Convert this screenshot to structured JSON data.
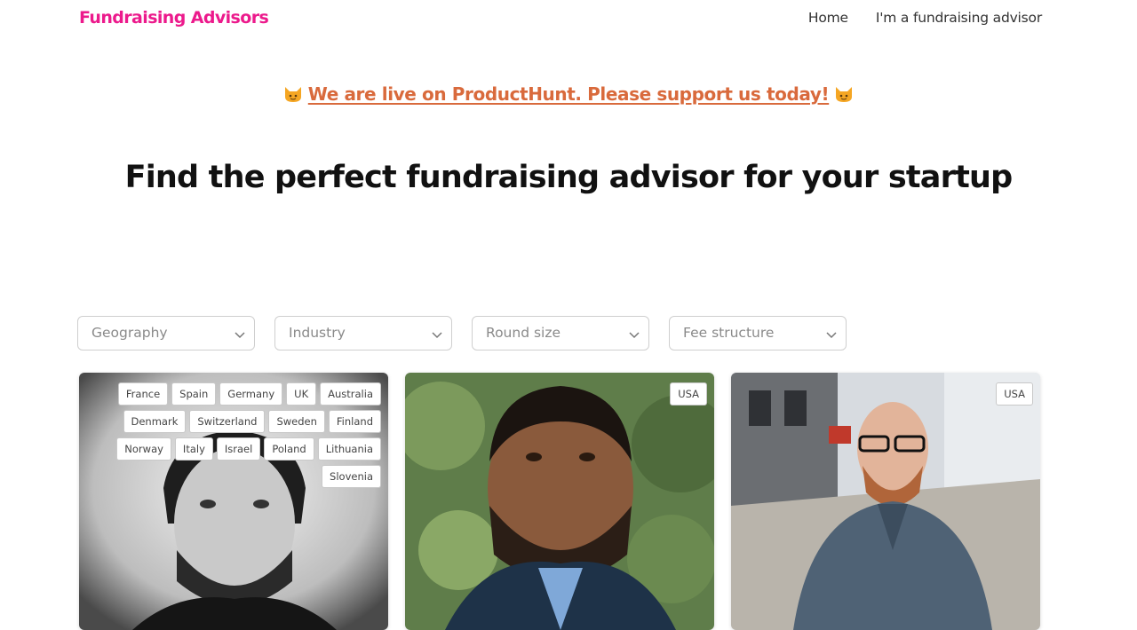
{
  "nav": {
    "brand": "Fundraising Advisors",
    "links": [
      "Home",
      "I'm a fundraising advisor"
    ]
  },
  "promo": {
    "text": "We are live on ProductHunt. Please support us today!",
    "icon": "cat-emoji-icon"
  },
  "hero": {
    "title": "Find the perfect fundraising advisor for your startup"
  },
  "filters": [
    {
      "placeholder": "Geography"
    },
    {
      "placeholder": "Industry"
    },
    {
      "placeholder": "Round size"
    },
    {
      "placeholder": "Fee structure"
    }
  ],
  "advisors": [
    {
      "countries": [
        "France",
        "Spain",
        "Germany",
        "UK",
        "Australia",
        "Denmark",
        "Switzerland",
        "Sweden",
        "Finland",
        "Norway",
        "Italy",
        "Israel",
        "Poland",
        "Lithuania",
        "Slovenia"
      ]
    },
    {
      "countries": [
        "USA"
      ]
    },
    {
      "countries": [
        "USA"
      ]
    }
  ],
  "colors": {
    "brand": "#ec1a8c",
    "promo": "#d96a3c"
  }
}
